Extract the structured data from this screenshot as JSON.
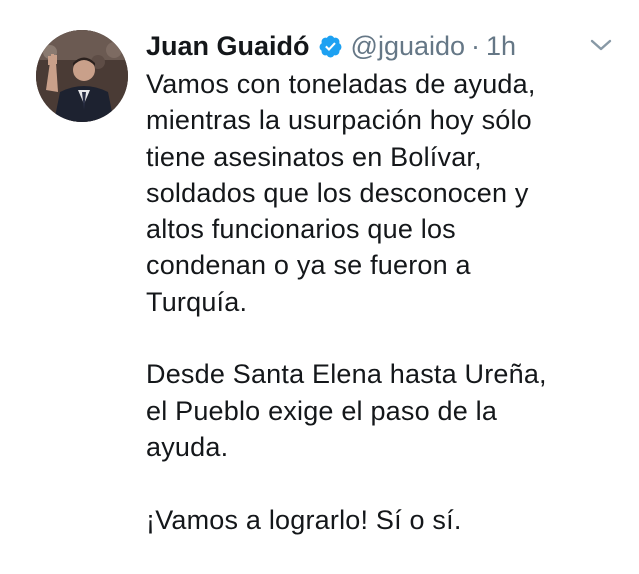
{
  "tweet": {
    "author": {
      "display_name": "Juan Guaidó",
      "handle": "@jguaido",
      "separator": "·",
      "time": "1h"
    },
    "text_lines": [
      "Vamos con toneladas de ayuda,",
      "mientras la usurpación hoy sólo",
      "tiene asesinatos en Bolívar,",
      "soldados que los desconocen y",
      "altos funcionarios que los",
      "condenan o ya se fueron a",
      "Turquía.",
      "",
      "Desde Santa Elena hasta Ureña,",
      "el Pueblo exige el paso de la",
      "ayuda.",
      "",
      "¡Vamos a lograrlo! Sí o sí."
    ],
    "icons": {
      "verified": "verified-badge-icon",
      "caret": "chevron-down-icon"
    },
    "colors": {
      "text": "#14171a",
      "secondary": "#657786",
      "verified": "#1da1f2"
    }
  }
}
